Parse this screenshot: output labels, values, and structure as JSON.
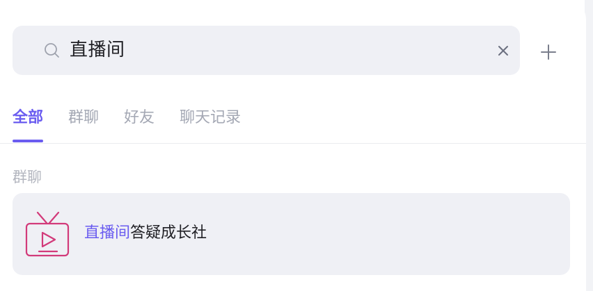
{
  "search": {
    "value": "直播间",
    "icon": "search-icon",
    "clear_icon": "close-icon",
    "add_icon": "plus-icon"
  },
  "tabs": [
    {
      "label": "全部",
      "active": true
    },
    {
      "label": "群聊",
      "active": false
    },
    {
      "label": "好友",
      "active": false
    },
    {
      "label": "聊天记录",
      "active": false
    }
  ],
  "sections": {
    "group_chats": {
      "label": "群聊",
      "results": [
        {
          "icon": "tv-live-icon",
          "title_highlight": "直播间",
          "title_rest": "答疑成长社"
        }
      ]
    }
  },
  "colors": {
    "accent": "#6a5cf0",
    "icon_pink": "#d23a7a",
    "search_bg": "#eff0f5",
    "muted_text": "#a4a8b4"
  }
}
